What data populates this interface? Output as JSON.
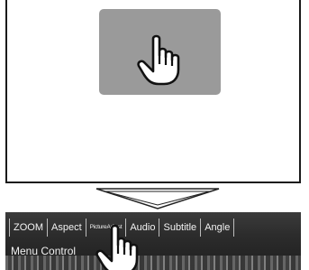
{
  "menu_bar": {
    "tabs": [
      {
        "label": "ZOOM"
      },
      {
        "label": "Aspect"
      },
      {
        "label": "PictureAdjust"
      },
      {
        "label": "Audio"
      },
      {
        "label": "Subtitle"
      },
      {
        "label": "Angle"
      }
    ],
    "menu_control_label": "Menu Control"
  },
  "colors": {
    "touch_area": "#9a9a9a",
    "menu_bar_background": "#2c2c2c",
    "menu_text": "#f2f2f2"
  },
  "icons": {
    "touch_hand": "pointing-hand-icon",
    "transition": "down-arrow-icon"
  }
}
